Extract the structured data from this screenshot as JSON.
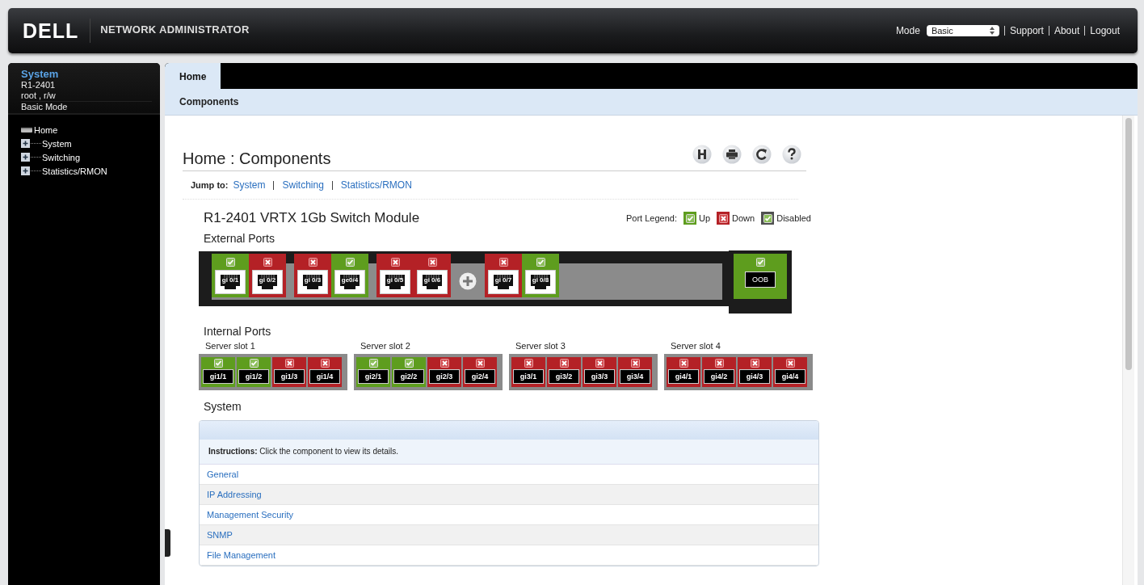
{
  "header": {
    "logo": "DELL",
    "title": "NETWORK ADMINISTRATOR",
    "mode_label": "Mode",
    "mode_select": {
      "value": "Basic"
    },
    "links": [
      "Support",
      "About",
      "Logout"
    ]
  },
  "sidebar": {
    "heading": "System",
    "info": [
      "R1-2401",
      "root , r/w",
      "Basic Mode"
    ],
    "tree": [
      {
        "label": "Home",
        "children": [
          {
            "label": "System",
            "expanded": false
          },
          {
            "label": "Switching",
            "expanded": false
          },
          {
            "label": "Statistics/RMON",
            "expanded": false
          }
        ]
      }
    ]
  },
  "tabs": [
    {
      "label": "Home",
      "selected": true
    }
  ],
  "subnav": "Components",
  "page_title": "Home : Components",
  "jump_to": {
    "label": "Jump to:",
    "links": [
      "System",
      "Switching",
      "Statistics/RMON"
    ]
  },
  "module": {
    "title": "R1-2401 VRTX 1Gb Switch Module",
    "legend_label": "Port Legend:",
    "legend": [
      {
        "kind": "check",
        "color": "#5e9d1e",
        "label": "Up"
      },
      {
        "kind": "cross",
        "color": "#b42126",
        "label": "Down"
      },
      {
        "kind": "check",
        "color": "#505050",
        "label": "Disabled"
      }
    ]
  },
  "external_ports": {
    "title": "External Ports",
    "items": [
      {
        "kind": "pair",
        "ports": [
          {
            "label": "gi 0/1",
            "up": true
          },
          {
            "label": "gi 0/2",
            "up": false
          }
        ]
      },
      {
        "kind": "pair",
        "ports": [
          {
            "label": "gi 0/3",
            "up": false
          },
          {
            "label": "ge0/4",
            "up": true
          }
        ]
      },
      {
        "kind": "pair",
        "ports": [
          {
            "label": "gi 0/5",
            "up": false
          },
          {
            "label": "gi 0/6",
            "up": false
          }
        ]
      },
      {
        "kind": "expansion"
      },
      {
        "kind": "pair",
        "ports": [
          {
            "label": "gi 0/7",
            "up": false
          },
          {
            "label": "gi 0/8",
            "up": true
          }
        ]
      }
    ],
    "oob": {
      "label": "OOB",
      "up": true
    }
  },
  "internal_ports": {
    "title": "Internal Ports",
    "slots": [
      {
        "title": "Server slot 1",
        "ports": [
          {
            "label": "gi1/1",
            "up": true
          },
          {
            "label": "gi1/2",
            "up": true
          },
          {
            "label": "gi1/3",
            "up": false
          },
          {
            "label": "gi1/4",
            "up": false
          }
        ]
      },
      {
        "title": "Server slot 2",
        "ports": [
          {
            "label": "gi2/1",
            "up": true
          },
          {
            "label": "gi2/2",
            "up": true
          },
          {
            "label": "gi2/3",
            "up": false
          },
          {
            "label": "gi2/4",
            "up": false
          }
        ]
      },
      {
        "title": "Server slot 3",
        "ports": [
          {
            "label": "gi3/1",
            "up": false
          },
          {
            "label": "gi3/2",
            "up": false
          },
          {
            "label": "gi3/3",
            "up": false
          },
          {
            "label": "gi3/4",
            "up": false
          }
        ]
      },
      {
        "title": "Server slot 4",
        "ports": [
          {
            "label": "gi4/1",
            "up": false
          },
          {
            "label": "gi4/2",
            "up": false
          },
          {
            "label": "gi4/3",
            "up": false
          },
          {
            "label": "gi4/4",
            "up": false
          }
        ]
      }
    ]
  },
  "system": {
    "title": "System",
    "instructions": "**Instructions:** Click the component to view its details.",
    "items": [
      "General",
      "IP Addressing",
      "Management Security",
      "SNMP",
      "File Management"
    ]
  }
}
